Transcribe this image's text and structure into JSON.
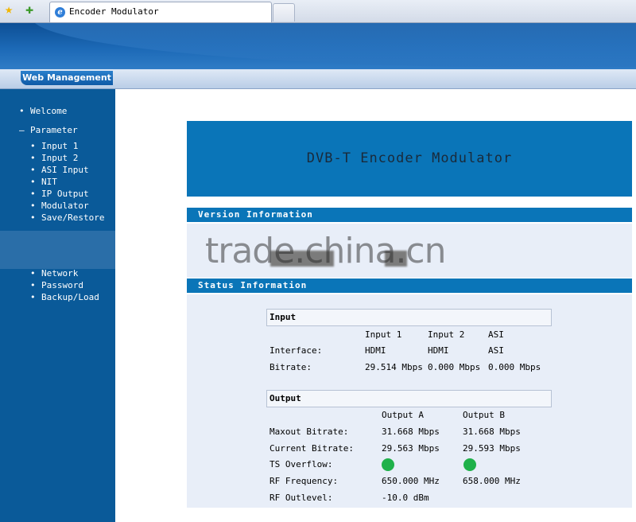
{
  "browser": {
    "tab_title": "Encoder Modulator"
  },
  "header": {
    "menu_label": "Web Management"
  },
  "sidebar": {
    "items": [
      {
        "marker": "•",
        "label": "Welcome"
      },
      {
        "marker": "–",
        "label": "Parameter"
      },
      {
        "marker": "•",
        "label": "Input 1"
      },
      {
        "marker": "•",
        "label": "Input 2"
      },
      {
        "marker": "•",
        "label": "ASI Input"
      },
      {
        "marker": "•",
        "label": "NIT"
      },
      {
        "marker": "•",
        "label": "IP Output"
      },
      {
        "marker": "•",
        "label": "Modulator"
      },
      {
        "marker": "•",
        "label": "Save/Restore"
      },
      {
        "marker": "•",
        "label": "Network"
      },
      {
        "marker": "•",
        "label": "Password"
      },
      {
        "marker": "•",
        "label": "Backup/Load"
      }
    ]
  },
  "main": {
    "title": "DVB-T Encoder Modulator",
    "version_section": {
      "title": "Version Information"
    },
    "watermark": "trade.china.cn",
    "status_section": {
      "title": "Status Information",
      "input": {
        "title": "Input",
        "columns": [
          "Input 1",
          "Input 2",
          "ASI"
        ],
        "interface_label": "Interface:",
        "interface_values": [
          "HDMI",
          "HDMI",
          "ASI"
        ],
        "bitrate_label": "Bitrate:",
        "bitrate_values": [
          "29.514 Mbps",
          "0.000 Mbps",
          "0.000 Mbps"
        ]
      },
      "output": {
        "title": "Output",
        "columns": [
          "Output A",
          "Output B"
        ],
        "maxout_label": "Maxout Bitrate:",
        "maxout_values": [
          "31.668 Mbps",
          "31.668 Mbps"
        ],
        "current_label": "Current Bitrate:",
        "current_values": [
          "29.563 Mbps",
          "29.593 Mbps"
        ],
        "ts_overflow_label": "TS Overflow:",
        "ts_overflow_colors": [
          "#1fb14a",
          "#1fb14a"
        ],
        "rf_freq_label": "RF Frequency:",
        "rf_freq_values": [
          "650.000 MHz",
          "658.000 MHz"
        ],
        "rf_outlevel_label": "RF Outlevel:",
        "rf_outlevel_value": "-10.0 dBm"
      }
    }
  }
}
